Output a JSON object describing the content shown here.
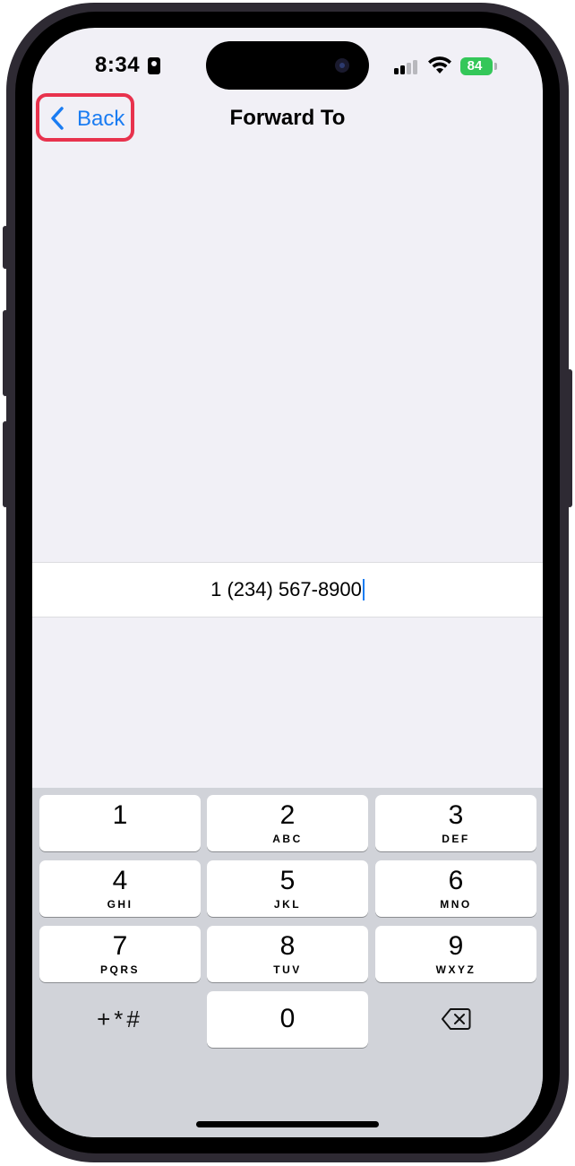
{
  "status_bar": {
    "time": "8:34",
    "battery_level": "84"
  },
  "nav": {
    "back_label": "Back",
    "title": "Forward To"
  },
  "phone_field": {
    "value": "1 (234) 567-8900"
  },
  "keypad": {
    "keys": [
      {
        "digit": "1",
        "letters": ""
      },
      {
        "digit": "2",
        "letters": "ABC"
      },
      {
        "digit": "3",
        "letters": "DEF"
      },
      {
        "digit": "4",
        "letters": "GHI"
      },
      {
        "digit": "5",
        "letters": "JKL"
      },
      {
        "digit": "6",
        "letters": "MNO"
      },
      {
        "digit": "7",
        "letters": "PQRS"
      },
      {
        "digit": "8",
        "letters": "TUV"
      },
      {
        "digit": "9",
        "letters": "WXYZ"
      },
      {
        "digit": "0",
        "letters": ""
      }
    ],
    "symbols_label": "+*#"
  },
  "colors": {
    "accent": "#1a7cf2",
    "highlight": "#e8324d",
    "battery": "#34c759"
  }
}
